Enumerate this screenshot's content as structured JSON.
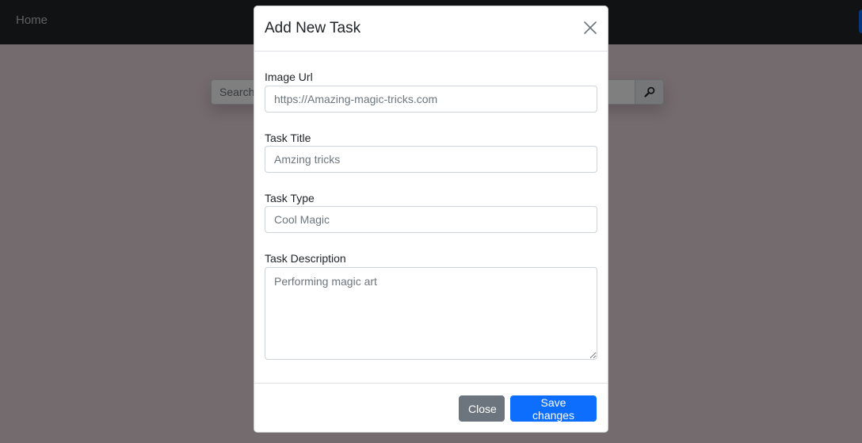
{
  "navbar": {
    "home_label": "Home"
  },
  "search": {
    "placeholder": "Search",
    "icon": "magnifier-icon"
  },
  "modal": {
    "title": "Add New Task",
    "close_icon": "close-icon",
    "fields": {
      "image_url": {
        "label": "Image Url",
        "placeholder": "https://Amazing-magic-tricks.com"
      },
      "task_title": {
        "label": "Task Title",
        "placeholder": "Amzing tricks"
      },
      "task_type": {
        "label": "Task Type",
        "placeholder": "Cool Magic"
      },
      "task_description": {
        "label": "Task Description",
        "placeholder": "Performing magic art"
      }
    },
    "footer": {
      "close_label": "Close",
      "save_label": "Save changes"
    }
  },
  "colors": {
    "navbar": "#212529",
    "primary": "#0d6efd",
    "secondary": "#6c757d"
  }
}
